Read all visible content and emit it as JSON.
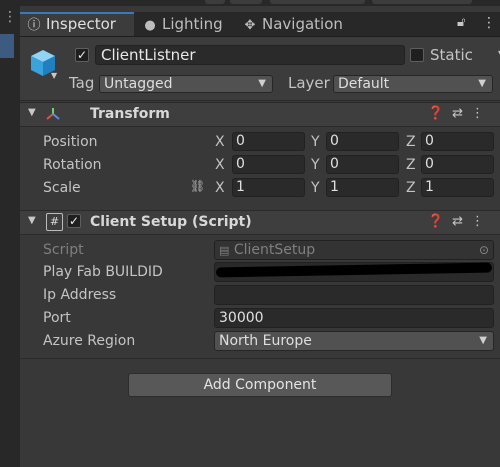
{
  "tabs": [
    {
      "label": "Inspector",
      "icon": "info-icon",
      "active": true
    },
    {
      "label": "Lighting",
      "icon": "bulb-icon",
      "active": false
    },
    {
      "label": "Navigation",
      "icon": "navigation-icon",
      "active": false
    }
  ],
  "header": {
    "enabled": true,
    "object_name": "ClientListner",
    "static_label": "Static",
    "tag_label": "Tag",
    "tag_value": "Untagged",
    "layer_label": "Layer",
    "layer_value": "Default"
  },
  "transform": {
    "title": "Transform",
    "rows": [
      {
        "label": "Position",
        "x": "0",
        "y": "0",
        "z": "0"
      },
      {
        "label": "Rotation",
        "x": "0",
        "y": "0",
        "z": "0"
      },
      {
        "label": "Scale",
        "x": "1",
        "y": "1",
        "z": "1"
      }
    ],
    "axis": {
      "x": "X",
      "y": "Y",
      "z": "Z"
    }
  },
  "client_setup": {
    "title": "Client Setup (Script)",
    "enabled": true,
    "script_label": "Script",
    "script_value": "ClientSetup",
    "playfab_label": "Play Fab BUILDID",
    "ip_label": "Ip Address",
    "ip_value": "",
    "port_label": "Port",
    "port_value": "30000",
    "region_label": "Azure Region",
    "region_value": "North Europe"
  },
  "add_component_label": "Add Component",
  "colors": {
    "accent": "#3a79bb",
    "panel": "#383838",
    "field": "#2a2a2a"
  }
}
